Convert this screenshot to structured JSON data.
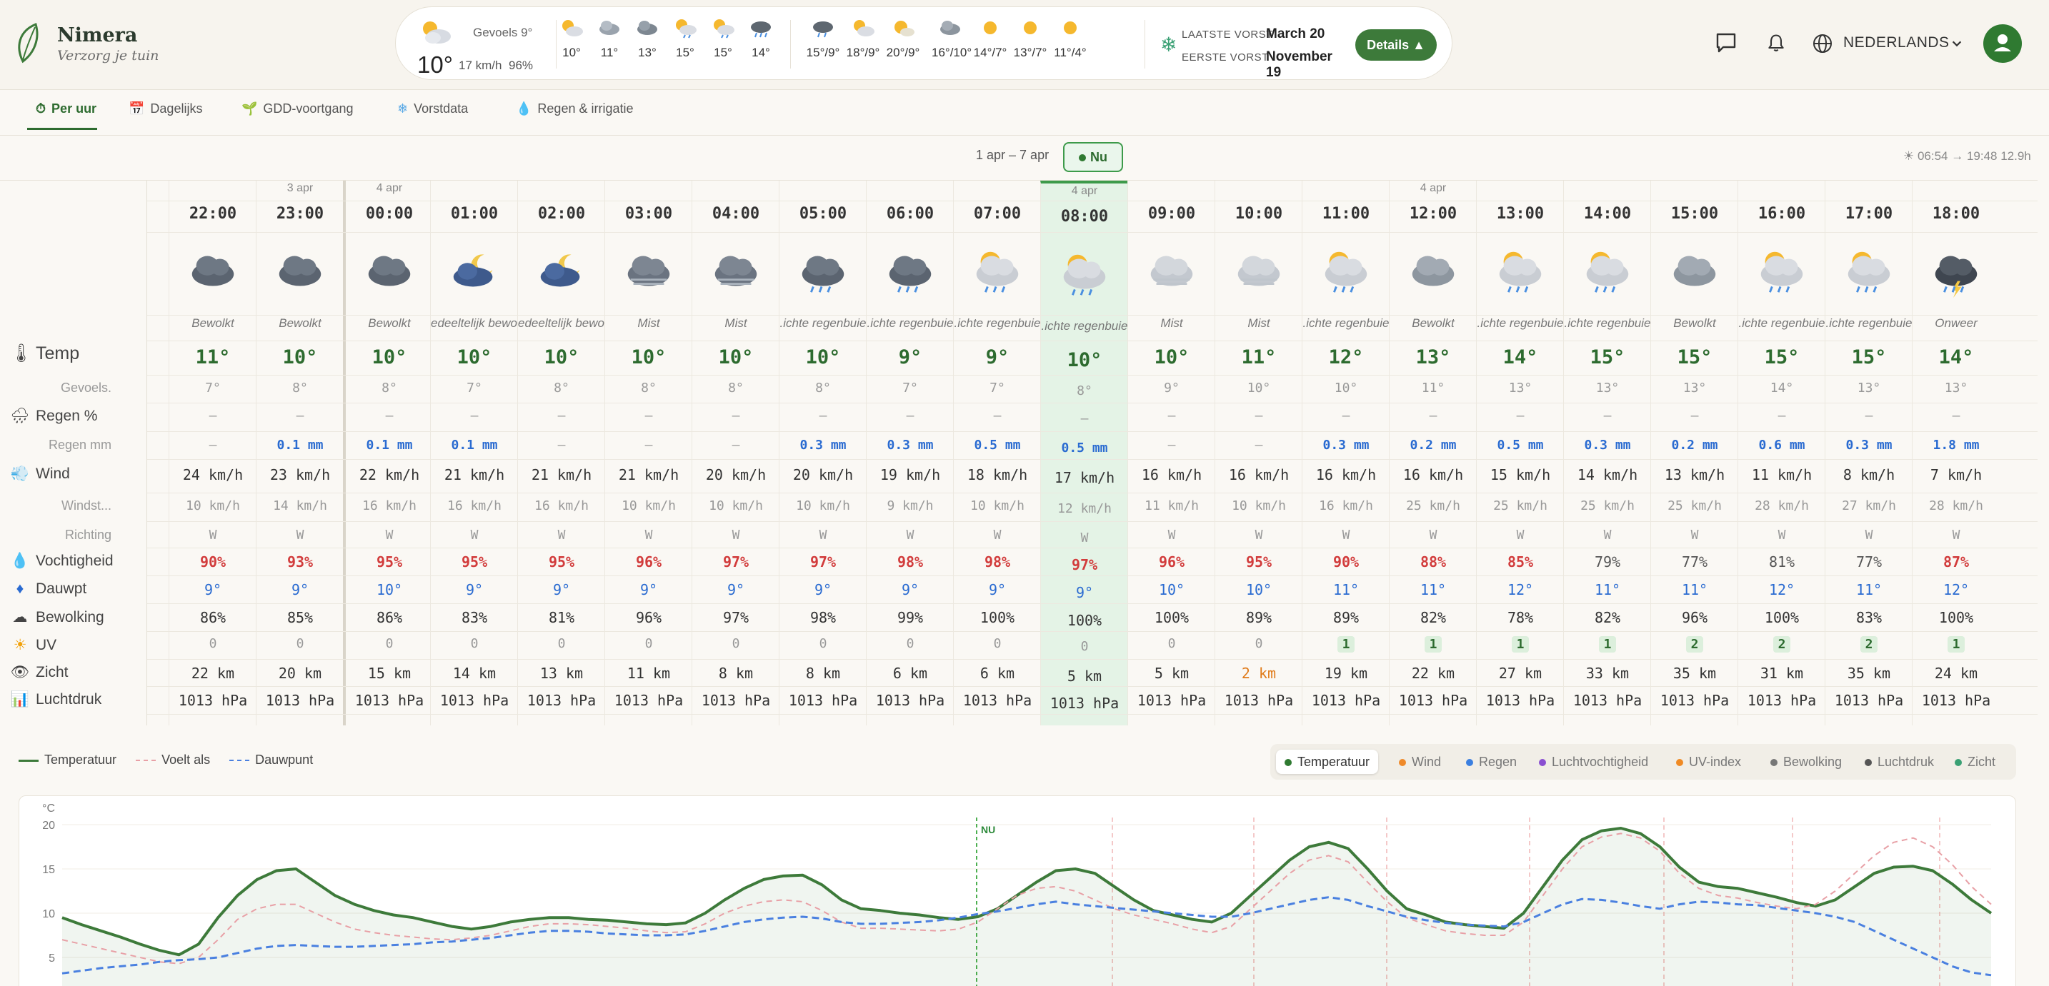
{
  "brand": {
    "name": "Nimera",
    "tagline": "Verzorg je tuin"
  },
  "current": {
    "feels": "Gevoels 9°",
    "temp": "10°",
    "wind": "17 km/h",
    "humidity": "96%"
  },
  "hourly_mini": [
    "10°",
    "11°",
    "13°",
    "15°",
    "15°",
    "14°"
  ],
  "daily_mini": [
    "15°/9°",
    "18°/9°",
    "20°/9°",
    "16°/10°",
    "14°/7°",
    "13°/7°",
    "11°/4°"
  ],
  "frost": {
    "last_label": "LAATSTE VORST",
    "last_value": "March 20",
    "first_label": "EERSTE VORST",
    "first_value": "November 19",
    "details": "Details ▲"
  },
  "header": {
    "language": "NEDERLANDS"
  },
  "tabs": [
    {
      "label": "Per uur",
      "icon": "⏱"
    },
    {
      "label": "Dagelijks",
      "icon": "📅"
    },
    {
      "label": "GDD-voortgang",
      "icon": "🌱"
    },
    {
      "label": "Vorstdata",
      "icon": "❄"
    },
    {
      "label": "Regen & irrigatie",
      "icon": "💧"
    }
  ],
  "range": {
    "text": "1 apr – 7 apr",
    "now": "Nu",
    "sun": "☀ 06:54 → 19:48  12.9h"
  },
  "row_labels": {
    "temp": "Temp",
    "feels": "Gevoels.",
    "rain_pct": "Regen %",
    "rain_mm": "Regen mm",
    "wind": "Wind",
    "gust": "Windst...",
    "dir": "Richting",
    "humidity": "Vochtigheid",
    "dew": "Dauwpt",
    "cloud": "Bewolking",
    "uv": "UV",
    "vis": "Zicht",
    "pressure": "Luchtdruk"
  },
  "hours": [
    {
      "date": "",
      "hour": "22:00",
      "icon": "cloud",
      "cond": "Bewolkt",
      "temp": "11°",
      "feels": "7°",
      "rain_pct": "–",
      "rain_mm": "–",
      "wind": "24 km/h",
      "gust": "10 km/h",
      "dir": "W",
      "hum": "90%",
      "dew": "9°",
      "cloud": "86%",
      "uv": "0",
      "vis": "22 km",
      "pres": "1013 hPa"
    },
    {
      "date": "3 apr",
      "hour": "23:00",
      "icon": "cloud",
      "cond": "Bewolkt",
      "temp": "10°",
      "feels": "8°",
      "rain_pct": "–",
      "rain_mm": "0.1 mm",
      "wind": "23 km/h",
      "gust": "14 km/h",
      "dir": "W",
      "hum": "93%",
      "dew": "9°",
      "cloud": "85%",
      "uv": "0",
      "vis": "20 km",
      "pres": "1013 hPa"
    },
    {
      "date": "4 apr",
      "hour": "00:00",
      "icon": "cloud",
      "cond": "Bewolkt",
      "temp": "10°",
      "feels": "8°",
      "rain_pct": "–",
      "rain_mm": "0.1 mm",
      "wind": "22 km/h",
      "gust": "16 km/h",
      "dir": "W",
      "hum": "95%",
      "dew": "10°",
      "cloud": "86%",
      "uv": "0",
      "vis": "15 km",
      "pres": "1013 hPa"
    },
    {
      "date": "",
      "hour": "01:00",
      "icon": "moon",
      "cond": "edeeltelijk bewol",
      "temp": "10°",
      "feels": "7°",
      "rain_pct": "–",
      "rain_mm": "0.1 mm",
      "wind": "21 km/h",
      "gust": "16 km/h",
      "dir": "W",
      "hum": "95%",
      "dew": "9°",
      "cloud": "83%",
      "uv": "0",
      "vis": "14 km",
      "pres": "1013 hPa"
    },
    {
      "date": "",
      "hour": "02:00",
      "icon": "moon",
      "cond": "edeeltelijk bewol",
      "temp": "10°",
      "feels": "8°",
      "rain_pct": "–",
      "rain_mm": "–",
      "wind": "21 km/h",
      "gust": "16 km/h",
      "dir": "W",
      "hum": "95%",
      "dew": "9°",
      "cloud": "81%",
      "uv": "0",
      "vis": "13 km",
      "pres": "1013 hPa"
    },
    {
      "date": "",
      "hour": "03:00",
      "icon": "fog",
      "cond": "Mist",
      "temp": "10°",
      "feels": "8°",
      "rain_pct": "–",
      "rain_mm": "–",
      "wind": "21 km/h",
      "gust": "10 km/h",
      "dir": "W",
      "hum": "96%",
      "dew": "9°",
      "cloud": "96%",
      "uv": "0",
      "vis": "11 km",
      "pres": "1013 hPa"
    },
    {
      "date": "",
      "hour": "04:00",
      "icon": "fog",
      "cond": "Mist",
      "temp": "10°",
      "feels": "8°",
      "rain_pct": "–",
      "rain_mm": "–",
      "wind": "20 km/h",
      "gust": "10 km/h",
      "dir": "W",
      "hum": "97%",
      "dew": "9°",
      "cloud": "97%",
      "uv": "0",
      "vis": "8 km",
      "pres": "1013 hPa"
    },
    {
      "date": "",
      "hour": "05:00",
      "icon": "nightrain",
      "cond": ".ichte regenbuie",
      "temp": "10°",
      "feels": "8°",
      "rain_pct": "–",
      "rain_mm": "0.3 mm",
      "wind": "20 km/h",
      "gust": "10 km/h",
      "dir": "W",
      "hum": "97%",
      "dew": "9°",
      "cloud": "98%",
      "uv": "0",
      "vis": "8 km",
      "pres": "1013 hPa"
    },
    {
      "date": "",
      "hour": "06:00",
      "icon": "nightrain",
      "cond": ".ichte regenbuie",
      "temp": "9°",
      "feels": "7°",
      "rain_pct": "–",
      "rain_mm": "0.3 mm",
      "wind": "19 km/h",
      "gust": "9 km/h",
      "dir": "W",
      "hum": "98%",
      "dew": "9°",
      "cloud": "99%",
      "uv": "0",
      "vis": "6 km",
      "pres": "1013 hPa"
    },
    {
      "date": "",
      "hour": "07:00",
      "icon": "sunrain",
      "cond": ".ichte regenbuie",
      "temp": "9°",
      "feels": "7°",
      "rain_pct": "–",
      "rain_mm": "0.5 mm",
      "wind": "18 km/h",
      "gust": "10 km/h",
      "dir": "W",
      "hum": "98%",
      "dew": "9°",
      "cloud": "100%",
      "uv": "0",
      "vis": "6 km",
      "pres": "1013 hPa"
    },
    {
      "date": "4 apr",
      "hour": "08:00",
      "icon": "sunrain",
      "cond": ".ichte regenbuie",
      "temp": "10°",
      "feels": "8°",
      "rain_pct": "–",
      "rain_mm": "0.5 mm",
      "wind": "17 km/h",
      "gust": "12 km/h",
      "dir": "W",
      "hum": "97%",
      "dew": "9°",
      "cloud": "100%",
      "uv": "0",
      "vis": "5 km",
      "pres": "1013 hPa"
    },
    {
      "date": "",
      "hour": "09:00",
      "icon": "fogday",
      "cond": "Mist",
      "temp": "10°",
      "feels": "9°",
      "rain_pct": "–",
      "rain_mm": "–",
      "wind": "16 km/h",
      "gust": "11 km/h",
      "dir": "W",
      "hum": "96%",
      "dew": "10°",
      "cloud": "100%",
      "uv": "0",
      "vis": "5 km",
      "pres": "1013 hPa"
    },
    {
      "date": "",
      "hour": "10:00",
      "icon": "fogday",
      "cond": "Mist",
      "temp": "11°",
      "feels": "10°",
      "rain_pct": "–",
      "rain_mm": "–",
      "wind": "16 km/h",
      "gust": "10 km/h",
      "dir": "W",
      "hum": "95%",
      "dew": "10°",
      "cloud": "89%",
      "uv": "0",
      "vis": "2 km",
      "pres": "1013 hPa"
    },
    {
      "date": "",
      "hour": "11:00",
      "icon": "sunrain",
      "cond": ".ichte regenbuie",
      "temp": "12°",
      "feels": "10°",
      "rain_pct": "–",
      "rain_mm": "0.3 mm",
      "wind": "16 km/h",
      "gust": "16 km/h",
      "dir": "W",
      "hum": "90%",
      "dew": "11°",
      "cloud": "89%",
      "uv": "1",
      "vis": "19 km",
      "pres": "1013 hPa"
    },
    {
      "date": "4 apr",
      "hour": "12:00",
      "icon": "cloudday",
      "cond": "Bewolkt",
      "temp": "13°",
      "feels": "11°",
      "rain_pct": "–",
      "rain_mm": "0.2 mm",
      "wind": "16 km/h",
      "gust": "25 km/h",
      "dir": "W",
      "hum": "88%",
      "dew": "11°",
      "cloud": "82%",
      "uv": "1",
      "vis": "22 km",
      "pres": "1013 hPa"
    },
    {
      "date": "",
      "hour": "13:00",
      "icon": "sunrain",
      "cond": ".ichte regenbuie",
      "temp": "14°",
      "feels": "13°",
      "rain_pct": "–",
      "rain_mm": "0.5 mm",
      "wind": "15 km/h",
      "gust": "25 km/h",
      "dir": "W",
      "hum": "85%",
      "dew": "12°",
      "cloud": "78%",
      "uv": "1",
      "vis": "27 km",
      "pres": "1013 hPa"
    },
    {
      "date": "",
      "hour": "14:00",
      "icon": "sunrain",
      "cond": ".ichte regenbuie",
      "temp": "15°",
      "feels": "13°",
      "rain_pct": "–",
      "rain_mm": "0.3 mm",
      "wind": "14 km/h",
      "gust": "25 km/h",
      "dir": "W",
      "hum": "79%",
      "dew": "11°",
      "cloud": "82%",
      "uv": "1",
      "vis": "33 km",
      "pres": "1013 hPa"
    },
    {
      "date": "",
      "hour": "15:00",
      "icon": "cloudday",
      "cond": "Bewolkt",
      "temp": "15°",
      "feels": "13°",
      "rain_pct": "–",
      "rain_mm": "0.2 mm",
      "wind": "13 km/h",
      "gust": "25 km/h",
      "dir": "W",
      "hum": "77%",
      "dew": "11°",
      "cloud": "96%",
      "uv": "2",
      "vis": "35 km",
      "pres": "1013 hPa"
    },
    {
      "date": "",
      "hour": "16:00",
      "icon": "sunrain",
      "cond": ".ichte regenbuie",
      "temp": "15°",
      "feels": "14°",
      "rain_pct": "–",
      "rain_mm": "0.6 mm",
      "wind": "11 km/h",
      "gust": "28 km/h",
      "dir": "W",
      "hum": "81%",
      "dew": "12°",
      "cloud": "100%",
      "uv": "2",
      "vis": "31 km",
      "pres": "1013 hPa"
    },
    {
      "date": "",
      "hour": "17:00",
      "icon": "sunrain",
      "cond": ".ichte regenbuie",
      "temp": "15°",
      "feels": "13°",
      "rain_pct": "–",
      "rain_mm": "0.3 mm",
      "wind": "8 km/h",
      "gust": "27 km/h",
      "dir": "W",
      "hum": "77%",
      "dew": "11°",
      "cloud": "83%",
      "uv": "2",
      "vis": "35 km",
      "pres": "1013 hPa"
    },
    {
      "date": "",
      "hour": "18:00",
      "icon": "thunder",
      "cond": "Onweer",
      "temp": "14°",
      "feels": "13°",
      "rain_pct": "–",
      "rain_mm": "1.8 mm",
      "wind": "7 km/h",
      "gust": "28 km/h",
      "dir": "W",
      "hum": "87%",
      "dew": "12°",
      "cloud": "100%",
      "uv": "1",
      "vis": "24 km",
      "pres": "1013 hPa"
    }
  ],
  "chart_legend": {
    "temp": "Temperatuur",
    "feels": "Voelt als",
    "dew": "Dauwpunt"
  },
  "metric_tabs": [
    "Temperatuur",
    "Wind",
    "Regen",
    "Luchtvochtigheid",
    "UV-index",
    "Bewolking",
    "Luchtdruk",
    "Zicht"
  ],
  "colors": {
    "accent": "#2d6b2f",
    "now_bg": "#e4f3e6",
    "humid_high": "#d23c3c",
    "rain_blue": "#2a6bd1",
    "vis_low": "#e07b1a"
  },
  "chart_data": {
    "type": "line",
    "ylabel": "°C",
    "yticks": [
      "20",
      "15",
      "10",
      "5"
    ],
    "ylim": [
      3,
      23
    ],
    "now_label": "NU",
    "series": [
      {
        "name": "Temperatuur",
        "values": [
          9.5,
          8.7,
          8.0,
          7.3,
          6.5,
          5.8,
          5.3,
          6.5,
          9.5,
          12.0,
          13.8,
          14.8,
          15.0,
          13.5,
          12.0,
          11.0,
          10.3,
          9.8,
          9.5,
          9.0,
          8.5,
          8.2,
          8.5,
          9.0,
          9.3,
          9.5,
          9.5,
          9.3,
          9.2,
          9.0,
          8.8,
          8.7,
          8.9,
          10.0,
          11.5,
          12.8,
          13.8,
          14.2,
          14.3,
          13.2,
          11.5,
          10.5,
          10.3,
          10.0,
          9.8,
          9.5,
          9.3,
          9.6,
          10.5,
          12.0,
          13.5,
          14.8,
          15.0,
          14.5,
          13.0,
          11.5,
          10.3,
          9.8,
          9.3,
          9.0,
          10.0,
          12.0,
          14.0,
          16.0,
          17.5,
          18.0,
          17.3,
          15.0,
          12.5,
          10.5,
          9.8,
          9.0,
          8.7,
          8.5,
          8.3,
          10.0,
          13.0,
          16.0,
          18.3,
          19.3,
          19.6,
          19.0,
          17.5,
          15.2,
          13.5,
          13.0,
          12.8,
          12.3,
          11.8,
          11.2,
          10.8,
          11.5,
          13.0,
          14.5,
          15.2,
          15.3,
          14.8,
          13.3,
          11.5,
          10.0
        ]
      },
      {
        "name": "Voelt als",
        "values": [
          7.0,
          6.5,
          6.0,
          5.5,
          5.0,
          4.5,
          4.3,
          5.0,
          7.0,
          9.3,
          10.5,
          11.0,
          11.0,
          10.0,
          9.0,
          8.2,
          7.8,
          7.5,
          7.3,
          7.1,
          7.0,
          7.2,
          7.5,
          8.0,
          8.5,
          8.8,
          8.8,
          8.7,
          8.5,
          8.3,
          8.0,
          7.8,
          7.9,
          8.8,
          10.0,
          10.8,
          11.3,
          11.5,
          11.3,
          10.3,
          9.0,
          8.3,
          8.3,
          8.2,
          8.1,
          8.0,
          8.2,
          9.0,
          10.5,
          12.0,
          12.8,
          13.0,
          12.5,
          11.5,
          10.5,
          9.8,
          9.3,
          8.8,
          8.2,
          7.8,
          8.5,
          10.5,
          12.5,
          14.5,
          16.0,
          16.5,
          15.8,
          13.5,
          11.3,
          9.5,
          8.7,
          8.0,
          7.7,
          7.5,
          7.5,
          9.0,
          12.0,
          15.0,
          17.5,
          18.6,
          19.0,
          18.5,
          17.0,
          14.5,
          12.8,
          12.0,
          11.7,
          11.2,
          10.8,
          10.5,
          11.0,
          12.5,
          14.5,
          16.5,
          18.0,
          18.5,
          17.5,
          15.5,
          13.0,
          11.0
        ]
      },
      {
        "name": "Dauwpunt",
        "values": [
          3.2,
          3.5,
          3.8,
          4.0,
          4.2,
          4.5,
          4.7,
          4.8,
          5.0,
          5.5,
          6.0,
          6.3,
          6.4,
          6.3,
          6.2,
          6.2,
          6.3,
          6.4,
          6.5,
          6.7,
          6.8,
          7.0,
          7.2,
          7.5,
          7.8,
          8.0,
          8.0,
          7.9,
          7.7,
          7.6,
          7.5,
          7.5,
          7.6,
          8.0,
          8.5,
          9.0,
          9.3,
          9.5,
          9.6,
          9.4,
          9.0,
          8.8,
          8.8,
          8.9,
          9.0,
          9.2,
          9.5,
          9.9,
          10.2,
          10.6,
          11.0,
          11.3,
          11.0,
          10.8,
          10.6,
          10.4,
          10.2,
          10.0,
          9.8,
          9.6,
          9.6,
          10.0,
          10.5,
          11.0,
          11.5,
          11.8,
          11.5,
          10.8,
          10.2,
          9.6,
          9.2,
          8.9,
          8.7,
          8.6,
          8.5,
          9.0,
          10.0,
          11.0,
          11.6,
          11.5,
          11.2,
          10.8,
          10.5,
          11.0,
          11.3,
          11.2,
          11.0,
          10.9,
          10.6,
          10.3,
          10.0,
          9.6,
          9.0,
          8.0,
          7.0,
          6.0,
          5.0,
          4.0,
          3.3,
          3.0
        ]
      }
    ]
  }
}
